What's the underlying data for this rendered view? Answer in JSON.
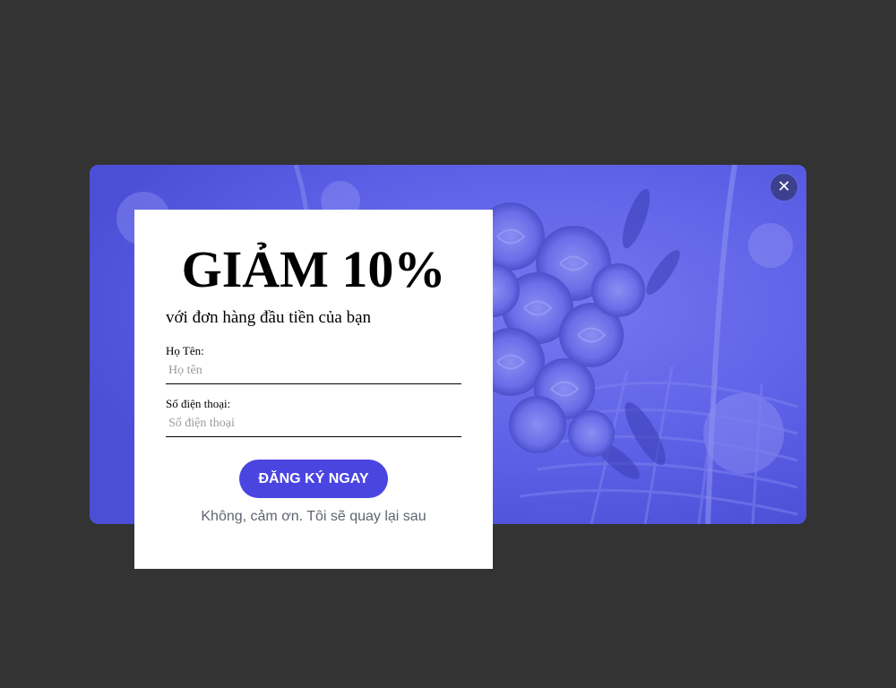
{
  "popup": {
    "headline": "GIẢM 10%",
    "subheadline": "với đơn hàng đầu tiền của bạn",
    "close_symbol": "✕",
    "close_icon": "close-icon",
    "banner_image": "flower-bouquet-image",
    "fields": [
      {
        "label": "Họ Tên:",
        "placeholder": "Họ tên",
        "value": ""
      },
      {
        "label": "Số điện thoại:",
        "placeholder": "Số điện thoại",
        "value": ""
      }
    ],
    "cta_label": "ĐĂNG KÝ NGAY",
    "decline_label": "Không, cảm ơn. Tôi sẽ quay lại sau"
  },
  "colors": {
    "backdrop": "#333333",
    "banner_tint": "#5b5fe6",
    "cta": "#4a45e0",
    "decline_text": "#5f6470"
  }
}
